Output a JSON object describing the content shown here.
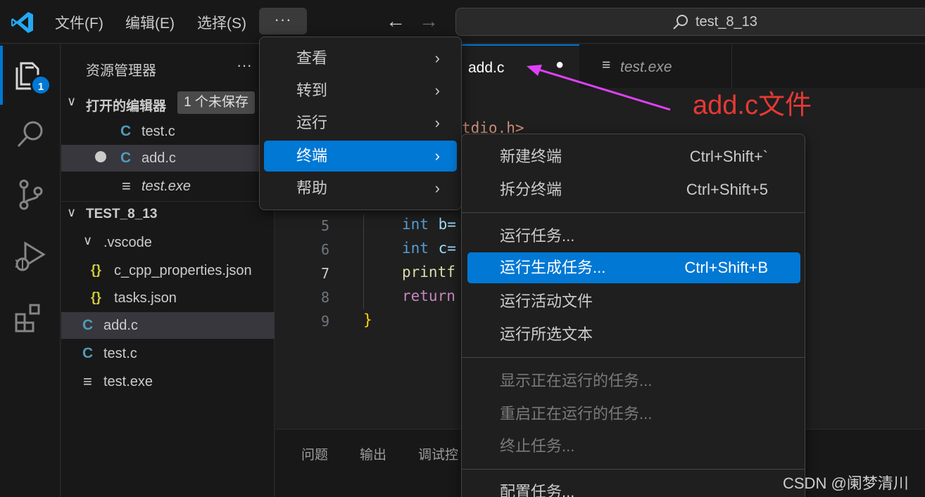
{
  "titlebar": {
    "menus": [
      "文件(F)",
      "编辑(E)",
      "选择(S)"
    ],
    "more_label": "···",
    "back_icon": "arrow-left-icon",
    "forward_icon": "arrow-right-icon",
    "search_text": "test_8_13"
  },
  "activity": {
    "explorer_badge": "1"
  },
  "sidebar": {
    "title": "资源管理器",
    "more_label": "···",
    "open_editors": {
      "label": "打开的编辑器",
      "unsaved": "1 个未保存",
      "items": [
        {
          "icon": "C",
          "name": "test.c"
        },
        {
          "icon": "C",
          "name": "add.c",
          "dirty": true
        },
        {
          "icon": "≡",
          "name": "test.exe"
        }
      ]
    },
    "folder": {
      "label": "TEST_8_13",
      "items": [
        {
          "icon": "",
          "name": ".vscode",
          "expanded": true
        },
        {
          "icon": "{}",
          "name": "c_cpp_properties.json"
        },
        {
          "icon": "{}",
          "name": "tasks.json"
        },
        {
          "icon": "C",
          "name": "add.c"
        },
        {
          "icon": "C",
          "name": "test.c"
        },
        {
          "icon": "≡",
          "name": "test.exe"
        }
      ]
    }
  },
  "editor": {
    "tabs": [
      {
        "name": "add.c",
        "dirty_dot": "●"
      },
      {
        "name": "test.exe"
      }
    ],
    "partial_include": "tdio.h>",
    "lines": [
      {
        "num": "5",
        "kw": "int",
        "rest": " b="
      },
      {
        "num": "6",
        "kw": "int",
        "rest": " c="
      },
      {
        "num": "7",
        "fn": "printf"
      },
      {
        "num": "8",
        "ret": "return"
      },
      {
        "num": "9",
        "brace": "}"
      }
    ],
    "panel_tabs": [
      "问题",
      "输出",
      "调试控"
    ]
  },
  "menu_main": {
    "items": [
      {
        "label": "查看",
        "chevron": "›"
      },
      {
        "label": "转到",
        "chevron": "›"
      },
      {
        "label": "运行",
        "chevron": "›"
      },
      {
        "label": "终端",
        "chevron": "›",
        "selected": true
      },
      {
        "label": "帮助",
        "chevron": "›"
      }
    ]
  },
  "menu_terminal": {
    "items": [
      {
        "label": "新建终端",
        "shortcut": "Ctrl+Shift+`"
      },
      {
        "label": "拆分终端",
        "shortcut": "Ctrl+Shift+5"
      },
      {
        "label": "运行任务..."
      },
      {
        "label": "运行生成任务...",
        "shortcut": "Ctrl+Shift+B",
        "selected": true
      },
      {
        "label": "运行活动文件"
      },
      {
        "label": "运行所选文本"
      },
      {
        "label": "显示正在运行的任务...",
        "disabled": true
      },
      {
        "label": "重启正在运行的任务...",
        "disabled": true
      },
      {
        "label": "终止任务...",
        "disabled": true
      },
      {
        "label": "配置任务..."
      }
    ]
  },
  "annotation": {
    "text": "add.c文件",
    "color": "#e53935",
    "arrow_color": "#e040fb"
  },
  "watermark": "CSDN @阑梦清川",
  "colors": {
    "accent": "#0078d4",
    "bg": "#1f1f1f",
    "sidebar_bg": "#181818"
  }
}
